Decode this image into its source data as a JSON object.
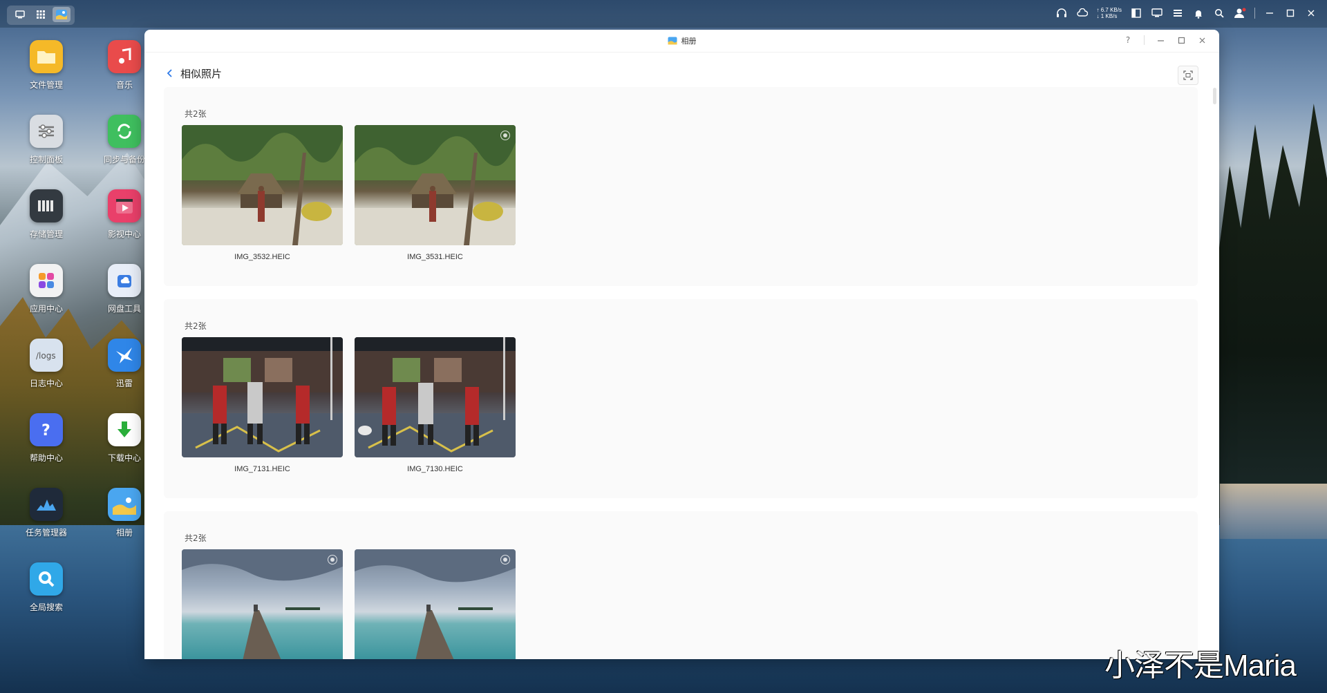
{
  "taskbar": {
    "net_up": "↑ 6.7 KB/s",
    "net_down": "↓ 1 KB/s"
  },
  "desktop_icons": [
    {
      "label": "文件管理",
      "color": "#f5b928",
      "icon": "folder-icon"
    },
    {
      "label": "音乐",
      "color": "#e94b4b",
      "icon": "music-note-icon"
    },
    {
      "label": "控制面板",
      "color": "#d9dde2",
      "icon": "sliders-icon"
    },
    {
      "label": "同步与备份",
      "color": "#3fbf5f",
      "icon": "sync-icon"
    },
    {
      "label": "存储管理",
      "color": "#333a41",
      "icon": "storage-icon"
    },
    {
      "label": "影视中心",
      "color": "#e9406a",
      "icon": "video-icon"
    },
    {
      "label": "应用中心",
      "color": "#f2f2f2",
      "icon": "apps-icon"
    },
    {
      "label": "网盘工具",
      "color": "#e8eef8",
      "icon": "cloud-drive-icon"
    },
    {
      "label": "日志中心",
      "color": "#d8e2ee",
      "icon": "logs-icon"
    },
    {
      "label": "迅雷",
      "color": "#2f86e8",
      "icon": "thunder-bird-icon"
    },
    {
      "label": "帮助中心",
      "color": "#4a6ef0",
      "icon": "help-icon"
    },
    {
      "label": "下载中心",
      "color": "#ffffff",
      "icon": "download-icon"
    },
    {
      "label": "任务管理器",
      "color": "#1f2a3a",
      "icon": "task-manager-icon"
    },
    {
      "label": "相册",
      "color": "#4aa6f0",
      "icon": "photos-icon"
    },
    {
      "label": "全局搜索",
      "color": "#30a8e8",
      "icon": "global-search-icon"
    }
  ],
  "window": {
    "title": "相册",
    "page_title": "相似照片",
    "controls": {
      "help": "?"
    }
  },
  "groups": [
    {
      "count": "共2张",
      "photos": [
        {
          "name": "IMG_3532.HEIC",
          "live": false
        },
        {
          "name": "IMG_3531.HEIC",
          "live": true
        }
      ]
    },
    {
      "count": "共2张",
      "photos": [
        {
          "name": "IMG_7131.HEIC",
          "live": false
        },
        {
          "name": "IMG_7130.HEIC",
          "live": false
        }
      ]
    },
    {
      "count": "共2张",
      "photos": [
        {
          "name": "",
          "live": true
        },
        {
          "name": "",
          "live": true
        }
      ]
    }
  ],
  "watermark": "小泽不是Maria"
}
